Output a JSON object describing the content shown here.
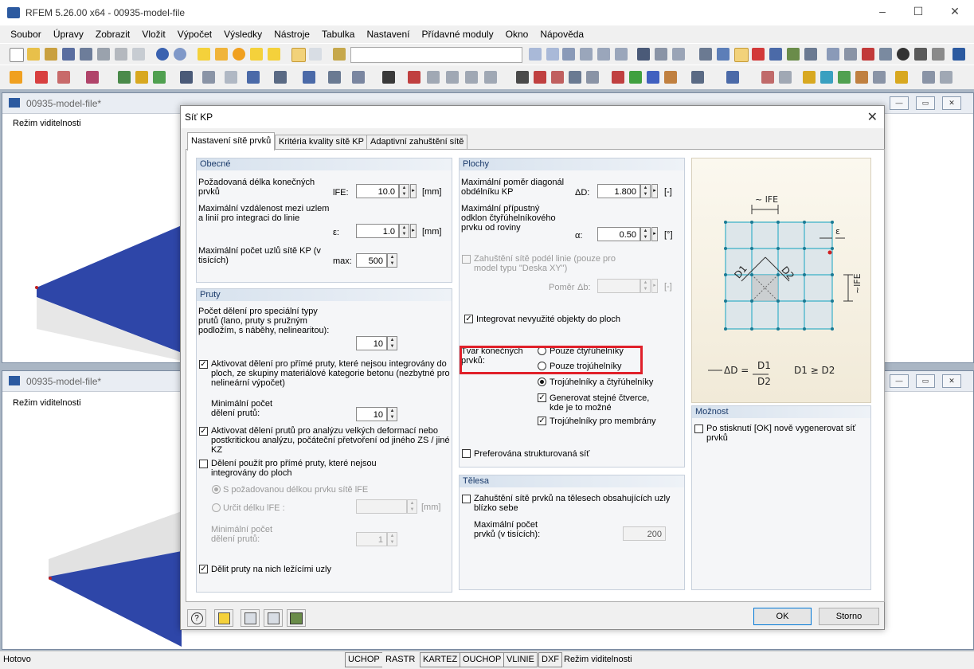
{
  "app": {
    "title": "RFEM 5.26.00 x64 - 00935-model-file",
    "window_controls": [
      "–",
      "☐",
      "✕"
    ]
  },
  "menu": [
    "Soubor",
    "Úpravy",
    "Zobrazit",
    "Vložit",
    "Výpočet",
    "Výsledky",
    "Nástroje",
    "Tabulka",
    "Nastavení",
    "Přídavné moduly",
    "Okno",
    "Nápověda"
  ],
  "mdi": [
    {
      "title": "00935-model-file*",
      "label": "Režim viditelnosti"
    },
    {
      "title": "00935-model-file*",
      "label": "Režim viditelnosti"
    }
  ],
  "dialog": {
    "title": "Síť KP",
    "tabs": [
      "Nastavení sítě prvků",
      "Kritéria kvality sítě KP",
      "Adaptivní zahuštění sítě"
    ],
    "general": {
      "header": "Obecné",
      "len_label": "Požadovaná délka konečných prvků",
      "len_sym": "lFE:",
      "len_value": "10.0",
      "len_unit": "[mm]",
      "eps_label": "Maximální vzdálenost mezi uzlem a linií pro integraci do linie",
      "eps_sym": "ε:",
      "eps_value": "1.0",
      "eps_unit": "[mm]",
      "max_label": "Maximální počet uzlů sítě KP (v tisících)",
      "max_sym": "max:",
      "max_value": "500"
    },
    "members": {
      "header": "Pruty",
      "div_label": "Počet dělení pro speciální typy prutů (lano, pruty s pružným podložím, s náběhy, nelinearitou):",
      "div_value": "10",
      "cb1": "Aktivovat dělení pro přímé pruty, které nejsou integrovány do ploch, ze skupiny materiálové kategorie betonu (nezbytné pro nelineární výpočet)",
      "min_div_label": "Minimální počet dělení prutů:",
      "min_div_value": "10",
      "cb2": "Aktivovat dělení prutů pro analýzu velkých deformací nebo postkritickou analýzu, počáteční přetvoření od jiného ZS / jiné KZ",
      "cb3": "Dělení použít pro přímé pruty, které nejsou integrovány do ploch",
      "rb1": "S požadovanou délkou prvku sítě lFE",
      "rb2": "Určit délku lFE :",
      "rb2_unit": "[mm]",
      "min_div2_label": "Minimální počet dělení prutů:",
      "min_div2_value": "1",
      "cb4": "Dělit pruty na nich ležícími uzly"
    },
    "surfaces": {
      "header": "Plochy",
      "ratio_label": "Maximální poměr diagonál obdélníku KP",
      "ratio_sym": "ΔD:",
      "ratio_value": "1.800",
      "ratio_unit": "[-]",
      "dev_label": "Maximální přípustný odklon čtyřúhelníkového prvku od roviny",
      "dev_sym": "α:",
      "dev_value": "0.50",
      "dev_unit": "[°]",
      "refine_label": "Zahuštění sítě podél linie (pouze pro model typu \"Deska XY\")",
      "refine_ratio_label": "Poměr",
      "refine_ratio_sym": "Δb:",
      "refine_ratio_unit": "[-]",
      "integrate_label": "Integrovat nevyužité objekty do ploch",
      "shape_label": "Tvar konečných prvků:",
      "shape_opt1": "Pouze čtyřúhelníky",
      "shape_opt2": "Pouze trojúhelníky",
      "shape_opt3": "Trojúhelníky a čtyřúhelníky",
      "squares_label": "Generovat stejné čtverce, kde je to možné",
      "membrane_label": "Trojúhelníky pro membrány",
      "structured_label": "Preferována strukturovaná síť"
    },
    "solids": {
      "header": "Tělesa",
      "refine_label": "Zahuštění sítě prvků na tělesech obsahujících uzly blízko sebe",
      "max_label": "Maximální počet prvků (v tisících):",
      "max_value": "200"
    },
    "diagram": {
      "lfe": "~ lFE",
      "eps": "ε",
      "d1": "D1",
      "d2": "D2",
      "lfe_v": "~lFE",
      "formula_lhs": "ΔD =",
      "formula_num": "D1",
      "formula_den": "D2",
      "formula_cond": "D1 ≥ D2"
    },
    "option": {
      "header": "Možnost",
      "regen_label": "Po stisknutí [OK] nově vygenerovat síť prvků"
    },
    "buttons": {
      "ok": "OK",
      "cancel": "Storno"
    }
  },
  "statusbar": {
    "left": "Hotovo",
    "toggles": [
      "UCHOP",
      "RASTR",
      "KARTEZ",
      "OUCHOP",
      "VLINIE",
      "DXF"
    ],
    "mode": "Režim viditelnosti"
  },
  "colors": {
    "highlight": "#e0202a",
    "plate_blue": "#2e46a8",
    "accent": "#1a3a6a"
  }
}
